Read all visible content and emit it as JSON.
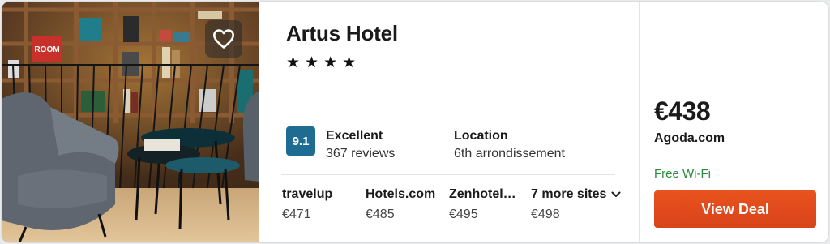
{
  "hotel": {
    "name": "Artus Hotel",
    "star_count": 4,
    "star_glyph": "★"
  },
  "rating": {
    "score": "9.1",
    "label": "Excellent",
    "reviews": "367 reviews",
    "badge_color": "#1f6c93"
  },
  "location": {
    "label": "Location",
    "value": "6th arrondissement"
  },
  "partners": [
    {
      "name": "travelup",
      "price": "€471"
    },
    {
      "name": "Hotels.com",
      "price": "€485"
    },
    {
      "name": "Zenhotel…",
      "price": "€495"
    }
  ],
  "more_sites": {
    "label": "7 more sites",
    "price": "€498",
    "icon": "chevron-down-icon"
  },
  "deal": {
    "price": "€438",
    "provider": "Agoda.com",
    "amenity": "Free Wi-Fi",
    "button_label": "View Deal",
    "button_color": "#e04b1c",
    "amenity_color": "#2a8a3e"
  },
  "photo": {
    "sign_text": "ROOM",
    "favorite_icon": "heart-icon"
  }
}
